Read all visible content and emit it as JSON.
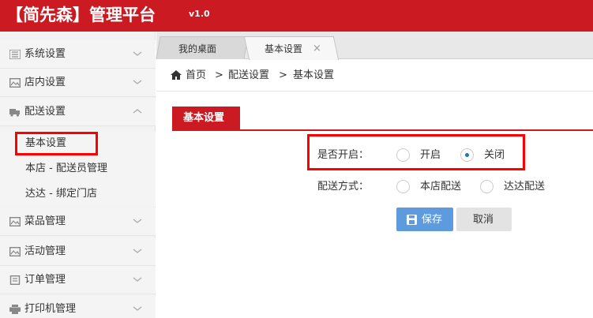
{
  "header": {
    "brand": "【简先森】管理平台",
    "version": "v1.0"
  },
  "sidebar": {
    "items": [
      {
        "label": "系统设置",
        "icon": "list-icon"
      },
      {
        "label": "店内设置",
        "icon": "image-icon"
      },
      {
        "label": "配送设置",
        "icon": "truck-icon",
        "expanded": true,
        "children": [
          {
            "label": "基本设置",
            "active": true
          },
          {
            "label": "本店 - 配送员管理"
          },
          {
            "label": "达达 - 绑定门店"
          }
        ]
      },
      {
        "label": "菜品管理",
        "icon": "image-icon"
      },
      {
        "label": "活动管理",
        "icon": "image-icon"
      },
      {
        "label": "订单管理",
        "icon": "document-icon"
      },
      {
        "label": "打印机管理",
        "icon": "printer-icon"
      }
    ]
  },
  "tabs": [
    {
      "label": "我的桌面",
      "active": false
    },
    {
      "label": "基本设置",
      "active": true,
      "close": "×"
    }
  ],
  "breadcrumb": {
    "home": "首页",
    "sep": ">",
    "level1": "配送设置",
    "level2": "基本设置"
  },
  "panel": {
    "title": "基本设置"
  },
  "form": {
    "enabled": {
      "label": "是否开启：",
      "options": [
        "开启",
        "关闭"
      ],
      "selected": "关闭"
    },
    "delivery_mode": {
      "label": "配送方式：",
      "options": [
        "本店配送",
        "达达配送"
      ],
      "selected": ""
    },
    "save_label": "保存",
    "cancel_label": "取消"
  },
  "colors": {
    "brand_red": "#cb1a22",
    "save_blue": "#5e9bde",
    "highlight_red": "#ff0000",
    "radio_checked": "#1a78b5"
  }
}
